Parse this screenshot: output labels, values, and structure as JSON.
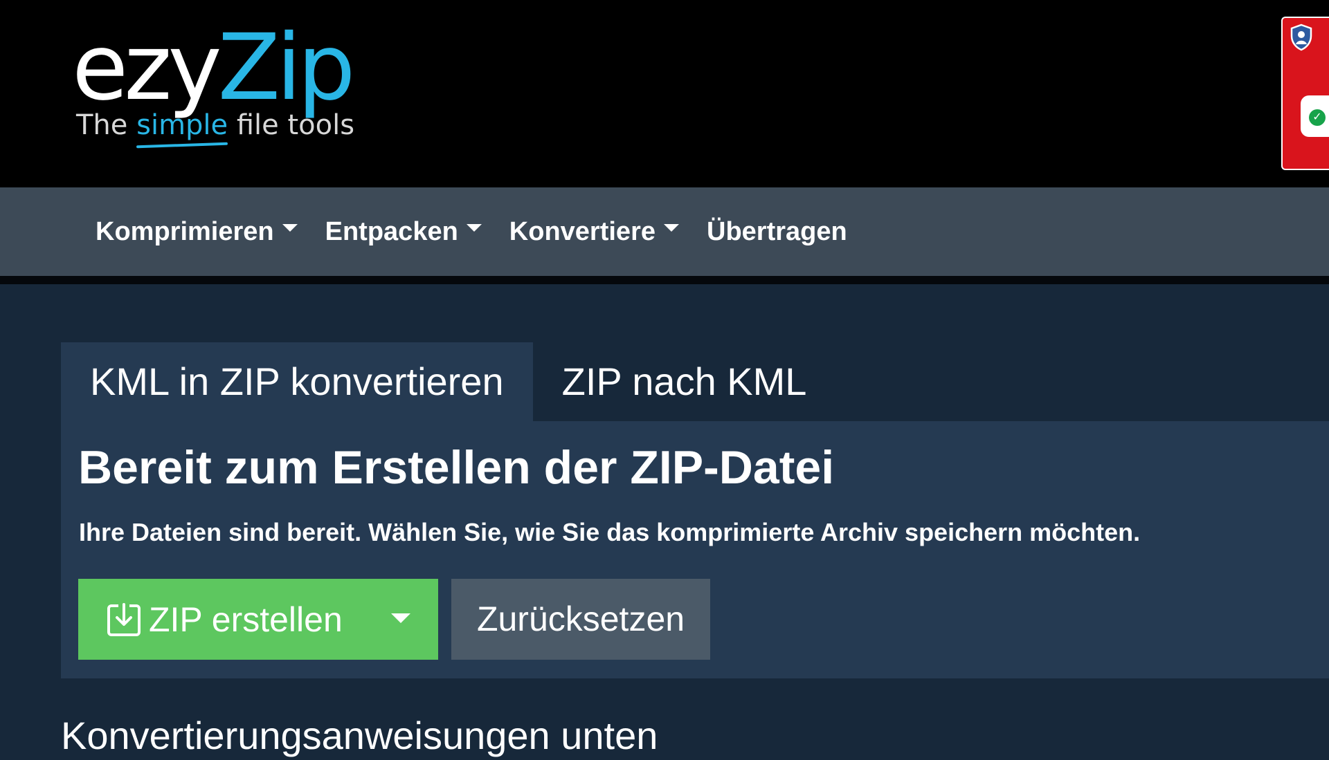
{
  "logo": {
    "word_part1": "ezy",
    "word_part2": "Zip",
    "tagline_pre": "The ",
    "tagline_highlight": "simple",
    "tagline_post": " file tools",
    "brand_color": "#29b6e6"
  },
  "extension": {
    "icon": "shield-icon",
    "status_icon": "check-icon",
    "color": "#d9141c"
  },
  "nav": {
    "items": [
      {
        "label": "Komprimieren",
        "has_dropdown": true
      },
      {
        "label": "Entpacken",
        "has_dropdown": true
      },
      {
        "label": "Konvertiere",
        "has_dropdown": true
      },
      {
        "label": "Übertragen",
        "has_dropdown": false
      }
    ]
  },
  "tabs": [
    {
      "label": "KML in ZIP konvertieren",
      "active": true
    },
    {
      "label": "ZIP nach KML",
      "active": false
    }
  ],
  "panel": {
    "title": "Bereit zum Erstellen der ZIP-Datei",
    "subtitle": "Ihre Dateien sind bereit. Wählen Sie, wie Sie das komprimierte Archiv speichern möchten.",
    "primary_button": {
      "label": "ZIP erstellen",
      "icon": "download-icon",
      "color": "#5dc75f"
    },
    "secondary_button": {
      "label": "Zurücksetzen"
    }
  },
  "instructions_heading": "Konvertierungsanweisungen unten"
}
